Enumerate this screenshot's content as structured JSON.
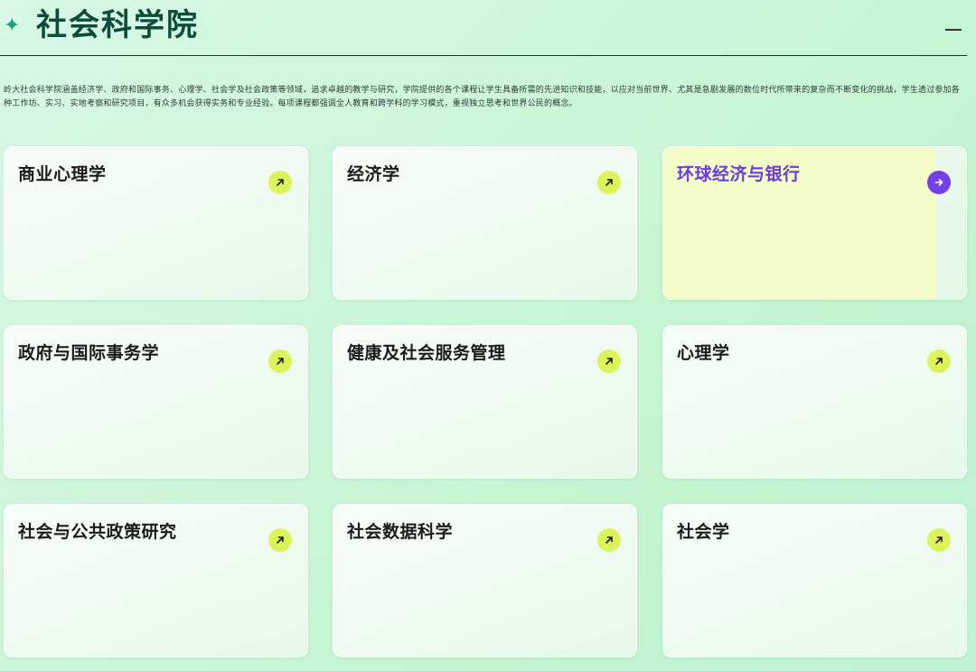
{
  "header": {
    "title": "社会科学院",
    "star_glyph": "✦",
    "collapse_glyph": "—"
  },
  "description": "岭大社会科学院涵盖经济学、政府和国际事务、心理学、社会学及社会政策等领域，追求卓越的教学与研究，学院提供的各个课程让学生具备所需的先进知识和技能，以应对当前世界、尤其是急剧发展的数位时代所带来的复杂而不断变化的挑战，学生透过参加各种工作坊、实习、实地考察和研究项目，有众多机会获得实务和专业经验。每项课程都强调全人教育和跨学科的学习模式，重视独立思考和世界公民的概念。",
  "colors": {
    "accent_lime": "#dcf35a",
    "accent_purple": "#7440e8",
    "title_green": "#0b4d3a",
    "star_green": "#1aa37a",
    "highlight_yellow": "#f4fcc8"
  },
  "programs": [
    {
      "label": "商业心理学",
      "icon": "arrow-up-right-icon",
      "active": false
    },
    {
      "label": "经济学",
      "icon": "arrow-up-right-icon",
      "active": false
    },
    {
      "label": "环球经济与银行",
      "icon": "arrow-right-icon",
      "active": true
    },
    {
      "label": "政府与国际事务学",
      "icon": "arrow-up-right-icon",
      "active": false
    },
    {
      "label": "健康及社会服务管理",
      "icon": "arrow-up-right-icon",
      "active": false
    },
    {
      "label": "心理学",
      "icon": "arrow-up-right-icon",
      "active": false
    },
    {
      "label": "社会与公共政策研究",
      "icon": "arrow-up-right-icon",
      "active": false
    },
    {
      "label": "社会数据科学",
      "icon": "arrow-up-right-icon",
      "active": false
    },
    {
      "label": "社会学",
      "icon": "arrow-up-right-icon",
      "active": false
    }
  ]
}
